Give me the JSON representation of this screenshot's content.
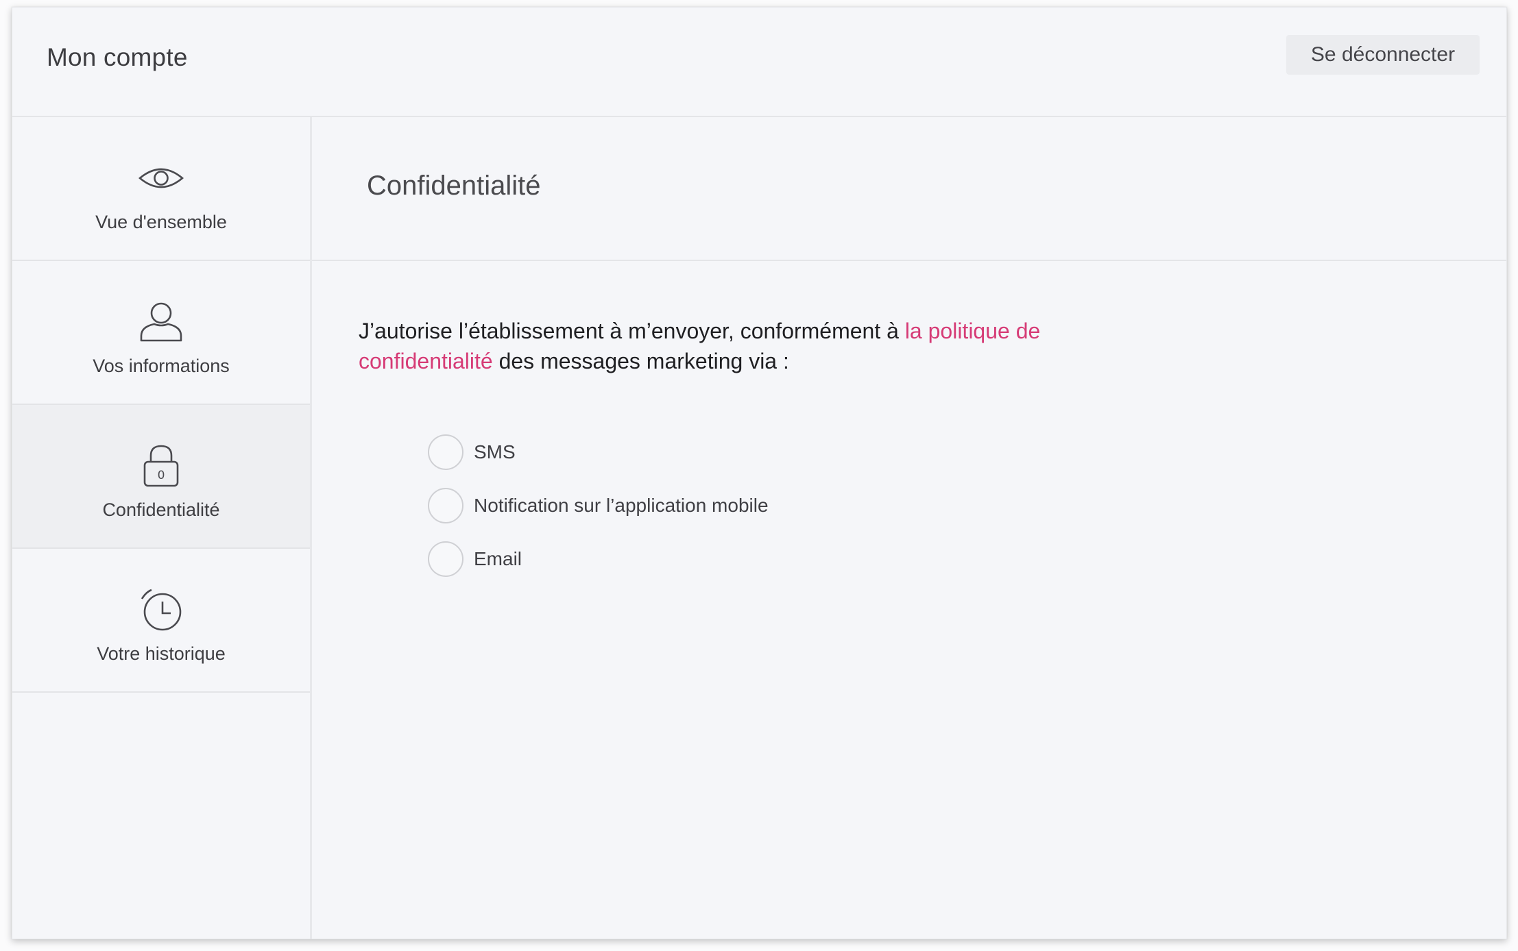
{
  "header": {
    "title": "Mon compte",
    "logout_label": "Se déconnecter"
  },
  "sidebar": {
    "items": [
      {
        "label": "Vue d'ensemble",
        "icon": "eye-icon",
        "active": false
      },
      {
        "label": "Vos informations",
        "icon": "user-icon",
        "active": false
      },
      {
        "label": "Confidentialité",
        "icon": "lock-icon",
        "icon_text": "0",
        "active": true
      },
      {
        "label": "Votre historique",
        "icon": "alarm-clock-icon",
        "active": false
      }
    ]
  },
  "main": {
    "section_title": "Confidentialité",
    "consent": {
      "text_before": "J’autorise l’établissement à m’envoyer, conformément à ",
      "link_text": "la politique de confidentialité",
      "text_after": " des messages marketing via :"
    },
    "options": [
      {
        "label": "SMS",
        "checked": false
      },
      {
        "label": "Notification sur l’application mobile",
        "checked": false
      },
      {
        "label": "Email",
        "checked": false
      }
    ]
  },
  "colors": {
    "accent_link": "#d63b76",
    "background": "#f5f6f9",
    "active_nav": "#eeeff2"
  }
}
